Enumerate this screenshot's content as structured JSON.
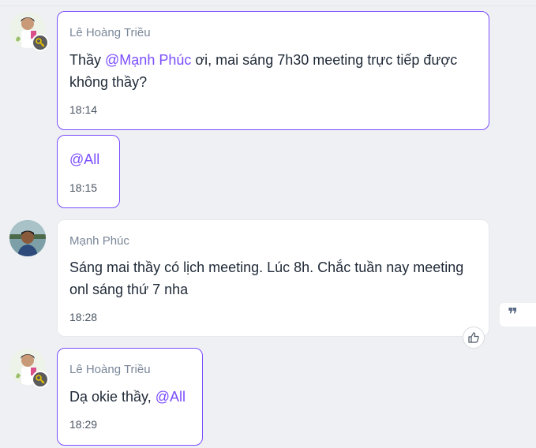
{
  "messages": [
    {
      "sender": "Lê Hoàng Triều",
      "text_before": "Thầy ",
      "mention": "@Mạnh Phúc",
      "text_after": " ơi, mai sáng 7h30 meeting trực tiếp được",
      "text_line2": "không thầy?",
      "time": "18:14"
    },
    {
      "mention": "@All",
      "time": "18:15"
    },
    {
      "sender": "Mạnh Phúc",
      "text_line1": "Sáng mai thầy có lịch meeting. Lúc 8h. Chắc tuần nay meeting",
      "text_line2": "onl sáng thứ 7 nha",
      "time": "18:28"
    },
    {
      "sender": "Lê Hoàng Triều",
      "text_before": "Dạ okie thầy, ",
      "mention": "@All",
      "time": "18:29"
    }
  ],
  "quote_icon": "quote-icon",
  "like_icon": "thumbs-up-icon",
  "colors": {
    "accent": "#7b4dff",
    "background": "#eef0f3"
  }
}
